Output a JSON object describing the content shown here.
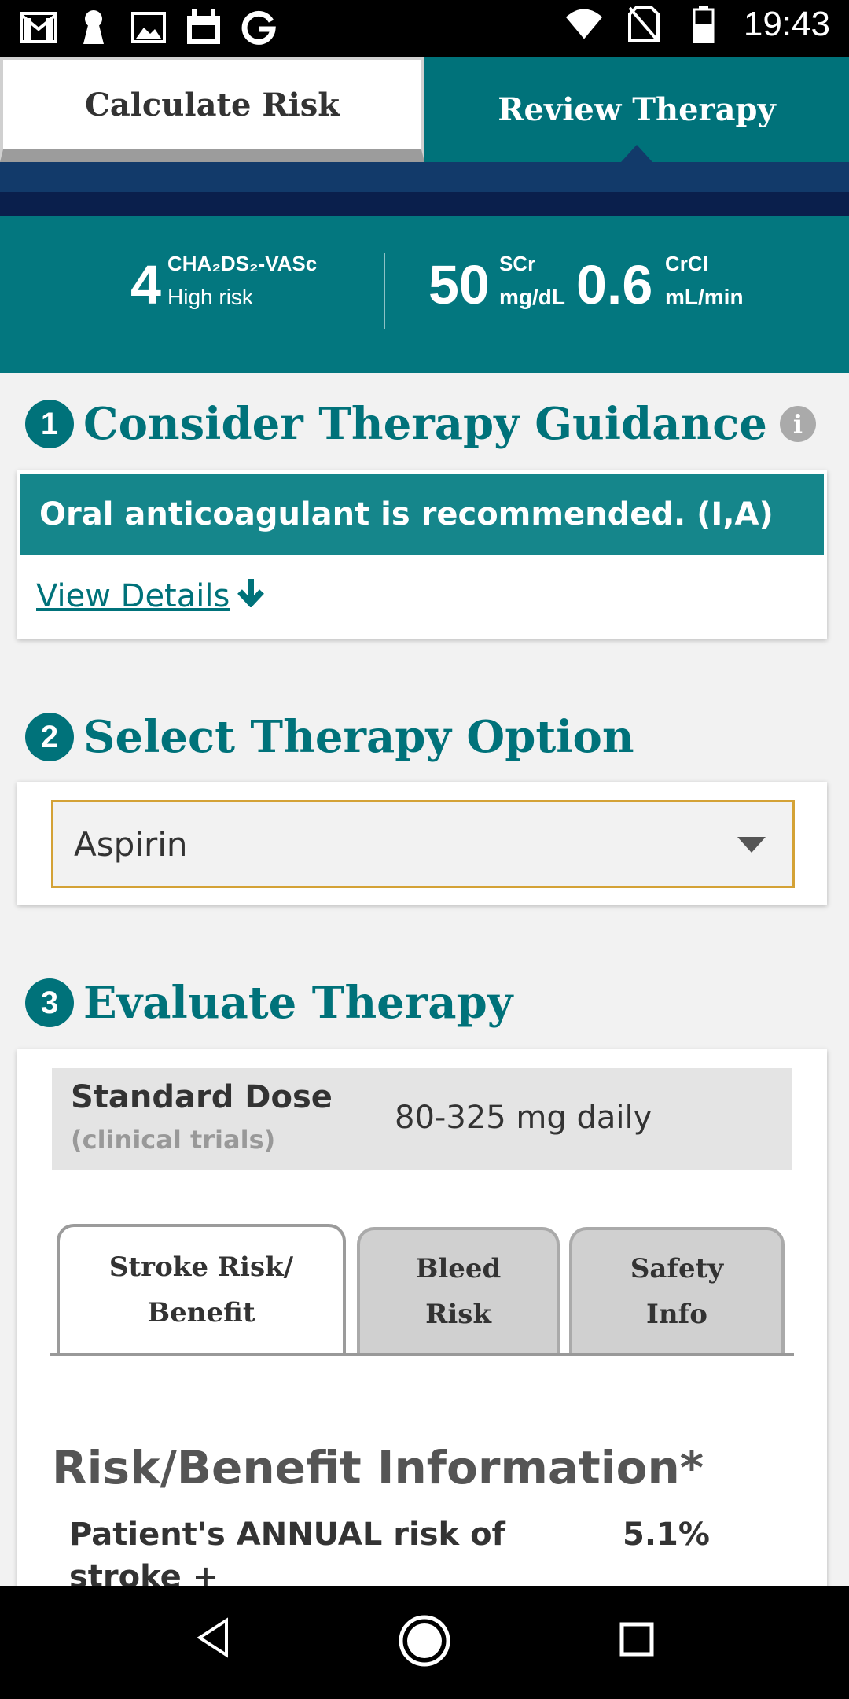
{
  "statusbar": {
    "time": "19:43"
  },
  "tabs": {
    "calculate": "Calculate Risk",
    "review": "Review Therapy"
  },
  "summary": {
    "score": "4",
    "score_label": "CHA₂DS₂-VASc",
    "risk_label": "High risk",
    "scr_value": "50",
    "scr_label": "SCr",
    "scr_unit": "mg/dL",
    "crcl_value": "0.6",
    "crcl_label": "CrCl",
    "crcl_unit": "mL/min"
  },
  "step1": {
    "num": "1",
    "title": "Consider Therapy Guidance",
    "info": "i",
    "recommendation": "Oral anticoagulant is recommended. (I,A)",
    "details_link": "View Details"
  },
  "step2": {
    "num": "2",
    "title": "Select Therapy Option",
    "selected": "Aspirin"
  },
  "step3": {
    "num": "3",
    "title": "Evaluate Therapy",
    "dose_title": "Standard Dose",
    "dose_sub": "(clinical trials)",
    "dose_value": "80-325 mg daily",
    "subtabs": [
      "Stroke Risk/ Benefit",
      "Bleed Risk",
      "Safety Info"
    ],
    "section_title": "Risk/Benefit Information*",
    "row_label": "Patient's ANNUAL risk of stroke + thromboembolism",
    "row_value": "5.1%"
  },
  "colors": {
    "teal": "#00727a",
    "navy": "#123a6a",
    "select_border": "#d4a236"
  },
  "icons": [
    "gmail-icon",
    "keyhole-icon",
    "image-icon",
    "calendar-icon",
    "google-icon",
    "wifi-icon",
    "no-sim-icon",
    "battery-icon",
    "info-icon",
    "down-arrow-icon",
    "dropdown-caret-icon",
    "back-nav-icon",
    "home-nav-icon",
    "recents-nav-icon"
  ]
}
